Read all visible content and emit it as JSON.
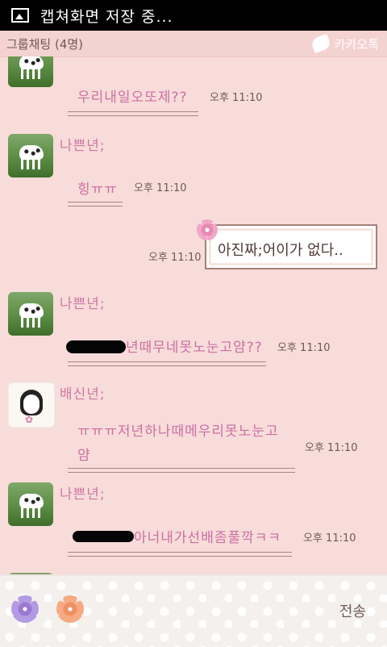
{
  "status_bar": {
    "text": "캡쳐화면 저장 중..."
  },
  "header": {
    "title": "그룹채팅 (4명)",
    "right_label": "카카오톡"
  },
  "messages": [
    {
      "text": "우리내일오또제??",
      "time": "오후 11:10"
    },
    {
      "sender": "나쁜년;",
      "text": "힝ㅠㅠ",
      "time": "오후 11:10"
    },
    {
      "text": "아진짜;어이가 없다..",
      "time": "오후 11:10"
    },
    {
      "sender": "나쁜년;",
      "text": "년때무네못노눈고얌??",
      "time": "오후 11:10"
    },
    {
      "sender": "배신년;",
      "text_line1": "ㅠㅠㅠ저년하나때메우리못노눈고",
      "text_line2": "얌",
      "time": "오후 11:10"
    },
    {
      "sender": "나쁜년;",
      "text": "아너내가선배좀풀깍ㅋㅋ",
      "time": "오후 11:10"
    }
  ],
  "input_bar": {
    "send_label": "전송"
  }
}
